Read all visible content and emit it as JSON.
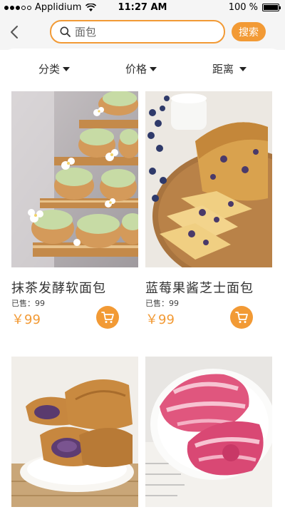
{
  "status_bar": {
    "carrier": "Applidium",
    "time": "11:27 AM",
    "battery": "100 %"
  },
  "header": {
    "search": {
      "placeholder": "面包",
      "value": ""
    },
    "search_button": "搜索"
  },
  "filters": [
    {
      "label": "分类"
    },
    {
      "label": "价格"
    },
    {
      "label": "距离"
    }
  ],
  "products": [
    {
      "name": "抹茶发酵软面包",
      "sold": "已售：99",
      "price": "￥99"
    },
    {
      "name": "蓝莓果酱芝士面包",
      "sold": "已售：99",
      "price": "￥99"
    },
    {
      "name": "",
      "sold": "",
      "price": ""
    },
    {
      "name": "",
      "sold": "",
      "price": ""
    }
  ],
  "colors": {
    "accent": "#f29a35",
    "background": "#f5f5f5"
  }
}
